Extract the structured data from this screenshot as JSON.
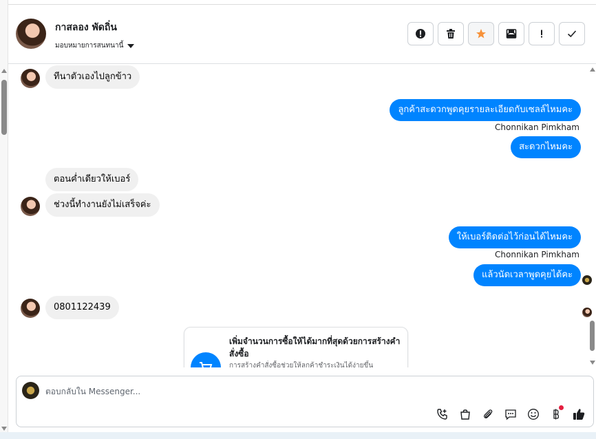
{
  "contact": {
    "name": "กาสลอง พัดถิ่น",
    "assign_label": "มอบหมายการสนทนานี้"
  },
  "actions": [
    {
      "name": "spam-icon",
      "label": "Mark as spam"
    },
    {
      "name": "trash-icon",
      "label": "Delete"
    },
    {
      "name": "star-icon",
      "label": "Star",
      "color": "#f7923a"
    },
    {
      "name": "mark-unread-icon",
      "label": "Mark as unread"
    },
    {
      "name": "follow-up-icon",
      "label": "Follow up"
    },
    {
      "name": "check-icon",
      "label": "Mark as done"
    }
  ],
  "messages": [
    {
      "from": "customer",
      "text": "ทีนาตัวเองไปลูกข้าว"
    },
    {
      "from": "page",
      "text": "ลูกค้าสะดวกพูดคุยรายละเอียดกับเซลล์ไหมคะ",
      "agent": "Chonnikan Pimkham"
    },
    {
      "from": "page",
      "text": "สะดวกไหมคะ"
    },
    {
      "from": "customer",
      "text": "ตอนค่ำเดียวให้เบอร์"
    },
    {
      "from": "customer",
      "text": "ช่วงนี้ทำงานยังไม่เสร็จค่ะ"
    },
    {
      "from": "page",
      "text": "ให้เบอร์ติดต่อไว้ก่อนได้ไหมคะ",
      "agent": "Chonnikan Pimkham"
    },
    {
      "from": "page",
      "text": "แล้วนัดเวลาพูดคุยได้คะ"
    },
    {
      "from": "customer",
      "text": "0801122439"
    }
  ],
  "order_card": {
    "title": "เพิ่มจำนวนการซื้อให้ได้มากที่สุดด้วยการสร้างคำสั่งซื้อ",
    "description": "การสร้างคำสั่งซื้อช่วยให้ลูกค้าชำระเงินได้ง่ายขึ้น"
  },
  "composer": {
    "placeholder": "ตอบกลับใน Messenger...",
    "tools": [
      "phone-plus-icon",
      "shopping-bag-icon",
      "paperclip-icon",
      "saved-replies-icon",
      "emoji-icon",
      "baht-icon",
      "thumbs-up-icon"
    ]
  },
  "colors": {
    "accent": "#0084ff",
    "incoming_bubble": "#f0f0f0",
    "star": "#f7923a",
    "badge": "#e41e3f"
  }
}
